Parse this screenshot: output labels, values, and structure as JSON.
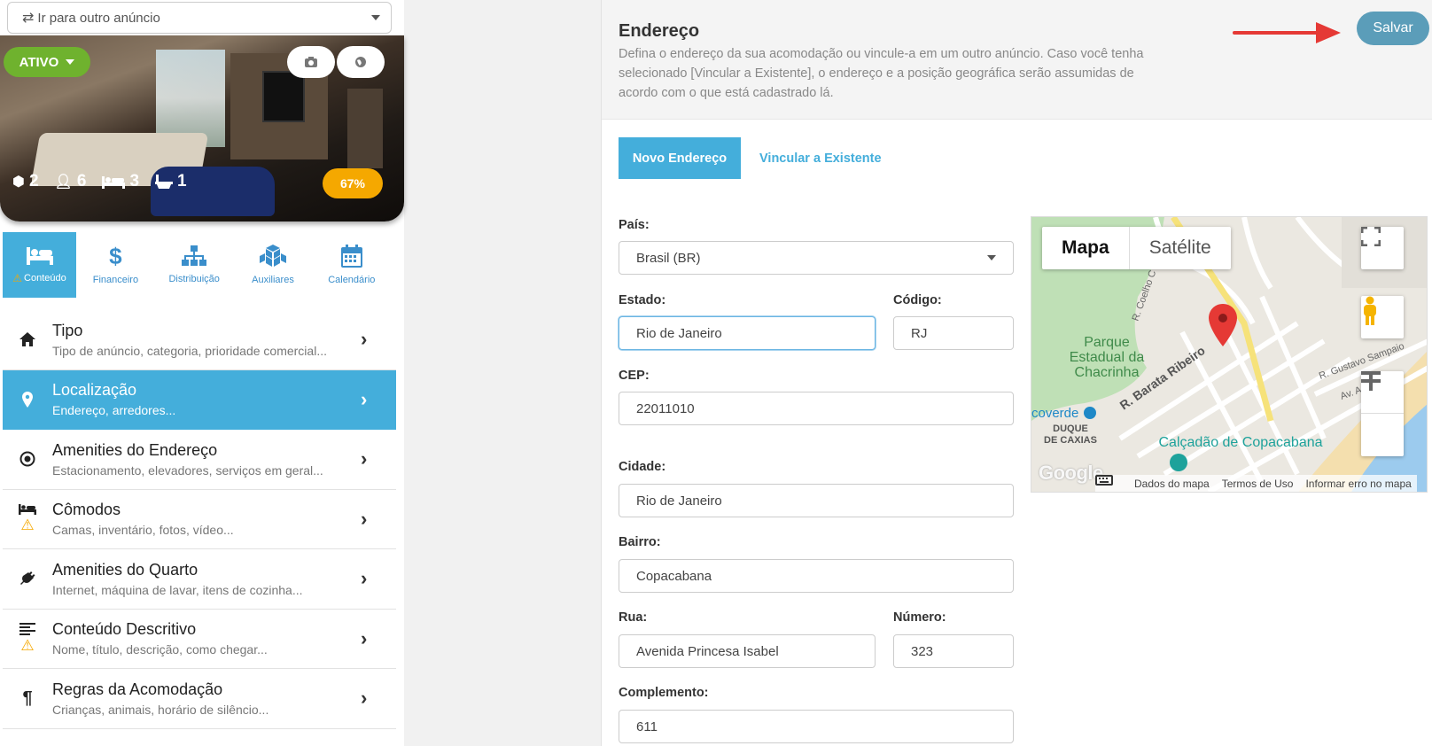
{
  "listing_select": {
    "label": "Ir para outro anúncio"
  },
  "hero": {
    "status": "ATIVO",
    "stats": [
      {
        "icon": "cube-icon",
        "value": "2"
      },
      {
        "icon": "user-icon",
        "value": "6"
      },
      {
        "icon": "bed-icon",
        "value": "3"
      },
      {
        "icon": "bath-icon",
        "value": "1"
      }
    ],
    "completion": "67%"
  },
  "tabs": [
    {
      "label": "Conteúdo",
      "icon": "bed-icon",
      "active": true,
      "warning": true
    },
    {
      "label": "Financeiro",
      "icon": "dollar-icon"
    },
    {
      "label": "Distribuição",
      "icon": "sitemap-icon"
    },
    {
      "label": "Auxiliares",
      "icon": "cubes-icon"
    },
    {
      "label": "Calendário",
      "icon": "calendar-icon"
    }
  ],
  "menu": [
    {
      "title": "Tipo",
      "subtitle": "Tipo de anúncio, categoria, prioridade comercial...",
      "icon": "home-icon"
    },
    {
      "title": "Localização",
      "subtitle": "Endereço, arredores...",
      "icon": "map-marker-icon",
      "active": true
    },
    {
      "title": "Amenities do Endereço",
      "subtitle": "Estacionamento, elevadores, serviços em geral...",
      "icon": "dot-circle-icon"
    },
    {
      "title": "Cômodos",
      "subtitle": "Camas, inventário, fotos, vídeo...",
      "icon": "bed-icon",
      "warning": true
    },
    {
      "title": "Amenities do Quarto",
      "subtitle": "Internet, máquina de lavar, itens de cozinha...",
      "icon": "plug-icon"
    },
    {
      "title": "Conteúdo Descritivo",
      "subtitle": "Nome, título, descrição, como chegar...",
      "icon": "align-left-icon",
      "warning": true
    },
    {
      "title": "Regras da Acomodação",
      "subtitle": "Crianças, animais, horário de silêncio...",
      "icon": "paragraph-icon"
    }
  ],
  "panel": {
    "title": "Endereço",
    "description": "Defina o endereço da sua acomodação ou vincule-a em um outro anúncio. Caso você tenha selecionado [Vincular a Existente], o endereço e a posição geográfica serão assumidas de acordo com o que está cadastrado lá.",
    "save_label": "Salvar",
    "seg_new": "Novo Endereço",
    "seg_link": "Vincular a Existente"
  },
  "form": {
    "pais_label": "País:",
    "pais_value": "Brasil (BR)",
    "estado_label": "Estado:",
    "estado_value": "Rio de Janeiro",
    "codigo_label": "Código:",
    "codigo_value": "RJ",
    "cep_label": "CEP:",
    "cep_value": "22011010",
    "cidade_label": "Cidade:",
    "cidade_value": "Rio de Janeiro",
    "bairro_label": "Bairro:",
    "bairro_value": "Copacabana",
    "rua_label": "Rua:",
    "rua_value": "Avenida Princesa Isabel",
    "numero_label": "Número:",
    "numero_value": "323",
    "complemento_label": "Complemento:",
    "complemento_value": "611"
  },
  "map": {
    "type_map": "Mapa",
    "type_satellite": "Satélite",
    "labels": {
      "park": [
        "Parque",
        "Estadual da",
        "Chacrinha"
      ],
      "street1": "R. Barata Ribeiro",
      "street2": "R. Gustavo Sampaio",
      "street3": "R. Coelho C",
      "street4": "Av. A",
      "metro": "coverde",
      "duque": [
        "DUQUE",
        "DE CAXIAS"
      ],
      "poi": "Calçadão de Copacabana"
    },
    "google": "Google",
    "footer": [
      "Dados do mapa",
      "Termos de Uso",
      "Informar erro no mapa"
    ]
  },
  "colors": {
    "accent": "#44aedb",
    "active_green": "#6fb22e",
    "warning": "#f5a800",
    "save": "#5b9db9",
    "arrow": "#e53935"
  }
}
